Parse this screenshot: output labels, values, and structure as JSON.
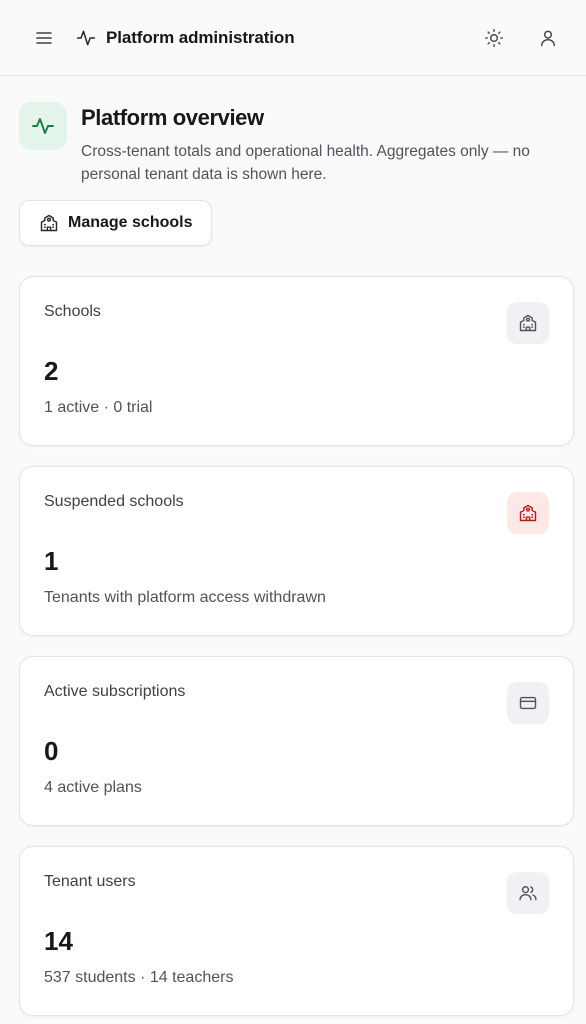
{
  "header": {
    "title": "Platform administration",
    "menu_icon": "menu-icon",
    "brand_icon": "activity-icon",
    "theme_icon": "sun-icon",
    "account_icon": "user-icon"
  },
  "overview": {
    "title": "Platform overview",
    "subtitle": "Cross-tenant totals and operational health. Aggregates only — no personal tenant data is shown here.",
    "icon": "activity-icon",
    "accent_bg": "#e3f5ea",
    "accent": "#15803d",
    "manage_button": "Manage schools"
  },
  "cards": [
    {
      "label": "Schools",
      "value": "2",
      "note": "1 active · 0 trial",
      "icon": "school-icon",
      "tone": "neutral"
    },
    {
      "label": "Suspended schools",
      "value": "1",
      "note": "Tenants with platform access withdrawn",
      "icon": "school-icon",
      "tone": "danger"
    },
    {
      "label": "Active subscriptions",
      "value": "0",
      "note": "4 active plans",
      "icon": "credit-card-icon",
      "tone": "neutral"
    },
    {
      "label": "Tenant users",
      "value": "14",
      "note": "537 students · 14 teachers",
      "icon": "users-icon",
      "tone": "neutral"
    }
  ],
  "colors": {
    "danger": "#b91c1c",
    "danger_bg": "#fde8e8"
  }
}
